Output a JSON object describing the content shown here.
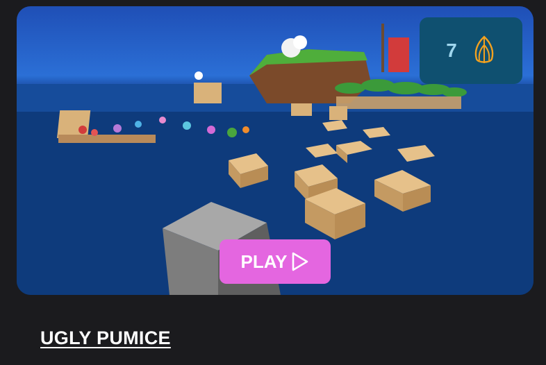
{
  "game_card": {
    "count": "7",
    "count_icon": "leaf-icon",
    "play_label": "PLAY",
    "play_icon": "play-triangle-icon",
    "title": "UGLY PUMICE"
  },
  "colors": {
    "page_background": "#1b1b1e",
    "badge_background": "#0f5070",
    "badge_text": "#9fd6ee",
    "icon_accent": "#f2a11f",
    "play_button": "#e466e0",
    "title_text": "#ffffff"
  }
}
